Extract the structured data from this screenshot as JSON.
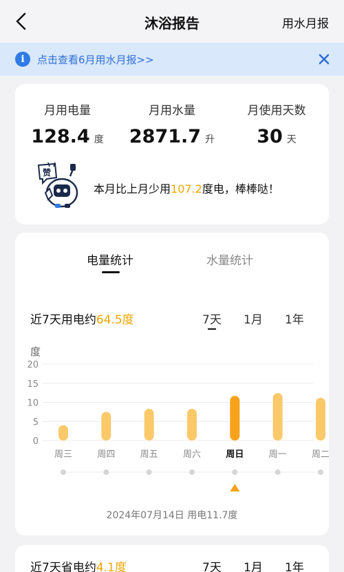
{
  "header": {
    "title": "沐浴报告",
    "right_label": "用水月报"
  },
  "banner": {
    "text": "点击查看6月用水月报>>",
    "icon": "info-icon",
    "accent": "#2f7be6"
  },
  "summary": {
    "stats": [
      {
        "label": "月用电量",
        "value": "128.4",
        "unit": "度"
      },
      {
        "label": "月用水量",
        "value": "2871.7",
        "unit": "升"
      },
      {
        "label": "月使用天数",
        "value": "30",
        "unit": "天"
      }
    ],
    "compare_prefix": "本月比上月少用",
    "compare_value": "107.2",
    "compare_suffix": "度电，棒棒哒！",
    "mascot_badge": "赞"
  },
  "stats_card": {
    "tabs": [
      {
        "label": "电量统计",
        "active": true
      },
      {
        "label": "水量统计",
        "active": false
      }
    ],
    "summary_prefix": "近7天用电约",
    "summary_value": "64.5度",
    "ranges": [
      "7天",
      "1月",
      "1年"
    ],
    "selected_range": "7天",
    "y_unit": "度",
    "footnote": "2024年07月14日 用电11.7度",
    "accent": "#f7a21b",
    "bar_color": "#fbc96a"
  },
  "chart_data": {
    "type": "bar",
    "categories": [
      "周三",
      "周四",
      "周五",
      "周六",
      "周日",
      "周一",
      "周二"
    ],
    "values": [
      4.0,
      7.5,
      8.3,
      8.3,
      11.7,
      12.4,
      11.2
    ],
    "selected_index": 4,
    "ylabel": "度",
    "yticks": [
      0,
      5,
      10,
      15,
      20
    ],
    "ylim": [
      0,
      20
    ],
    "grid": true
  },
  "savings_card": {
    "summary_prefix": "近7天省电约",
    "summary_value": "4.1度",
    "ranges": [
      "7天",
      "1月",
      "1年"
    ]
  }
}
